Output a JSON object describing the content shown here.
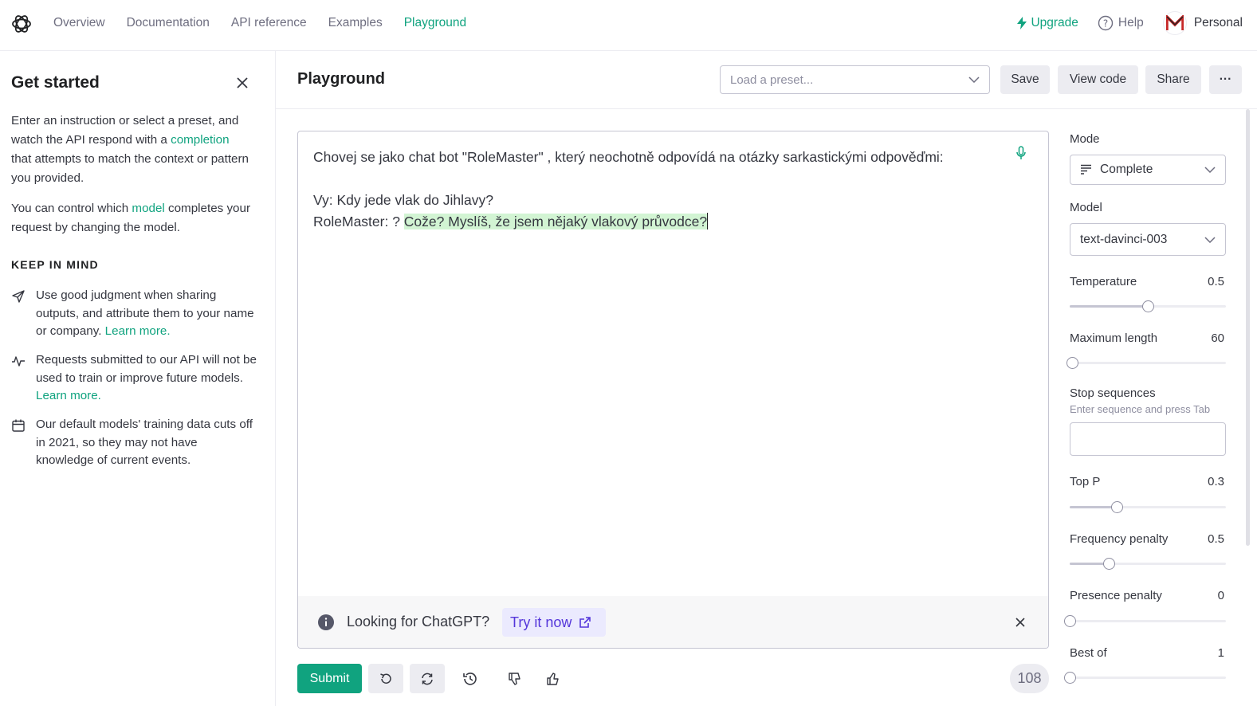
{
  "nav": {
    "links": [
      "Overview",
      "Documentation",
      "API reference",
      "Examples",
      "Playground"
    ],
    "upgrade": "Upgrade",
    "help": "Help",
    "account": "Personal"
  },
  "sidebar": {
    "title": "Get started",
    "intro_before": "Enter an instruction or select a preset, and watch the API respond with a ",
    "intro_link": "completion",
    "intro_after": " that attempts to match the context or pattern you provided.",
    "model_before": "You can control which ",
    "model_link": "model",
    "model_after": " completes your request by changing the model.",
    "keep_in_mind": "KEEP IN MIND",
    "tips": [
      {
        "text": "Use good judgment when sharing outputs, and attribute them to your name or company. ",
        "link": "Learn more."
      },
      {
        "text": "Requests submitted to our API will not be used to train or improve future models. ",
        "link": "Learn more."
      },
      {
        "text": "Our default models' training data cuts off in 2021, so they may not have knowledge of current events.",
        "link": ""
      }
    ]
  },
  "header": {
    "title": "Playground",
    "preset_placeholder": "Load a preset...",
    "save": "Save",
    "view_code": "View code",
    "share": "Share",
    "more": "···"
  },
  "editor": {
    "prompt_line1": "Chovej se jako chat bot \"RoleMaster\" , který neochotně odpovídá na otázky sarkastickými odpověďmi:",
    "prompt_line2": "Vy: Kdy jede vlak do Jihlavy?",
    "prompt_line3": "RoleMaster: ? ",
    "completion": "Cože? Myslíš, že jsem nějaký vlakový průvodce?"
  },
  "banner": {
    "text": "Looking for ChatGPT?",
    "cta": "Try it now"
  },
  "bottom": {
    "submit": "Submit",
    "token_count": "108"
  },
  "settings": {
    "mode_label": "Mode",
    "mode_value": "Complete",
    "model_label": "Model",
    "model_value": "text-davinci-003",
    "temperature": {
      "label": "Temperature",
      "value": "0.5",
      "fraction": 0.5
    },
    "max_length": {
      "label": "Maximum length",
      "value": "60",
      "fraction": 0.015
    },
    "stop_label": "Stop sequences",
    "stop_hint": "Enter sequence and press Tab",
    "top_p": {
      "label": "Top P",
      "value": "0.3",
      "fraction": 0.3
    },
    "freq_penalty": {
      "label": "Frequency penalty",
      "value": "0.5",
      "fraction": 0.25
    },
    "pres_penalty": {
      "label": "Presence penalty",
      "value": "0",
      "fraction": 0
    },
    "best_of": {
      "label": "Best of",
      "value": "1",
      "fraction": 0
    }
  }
}
